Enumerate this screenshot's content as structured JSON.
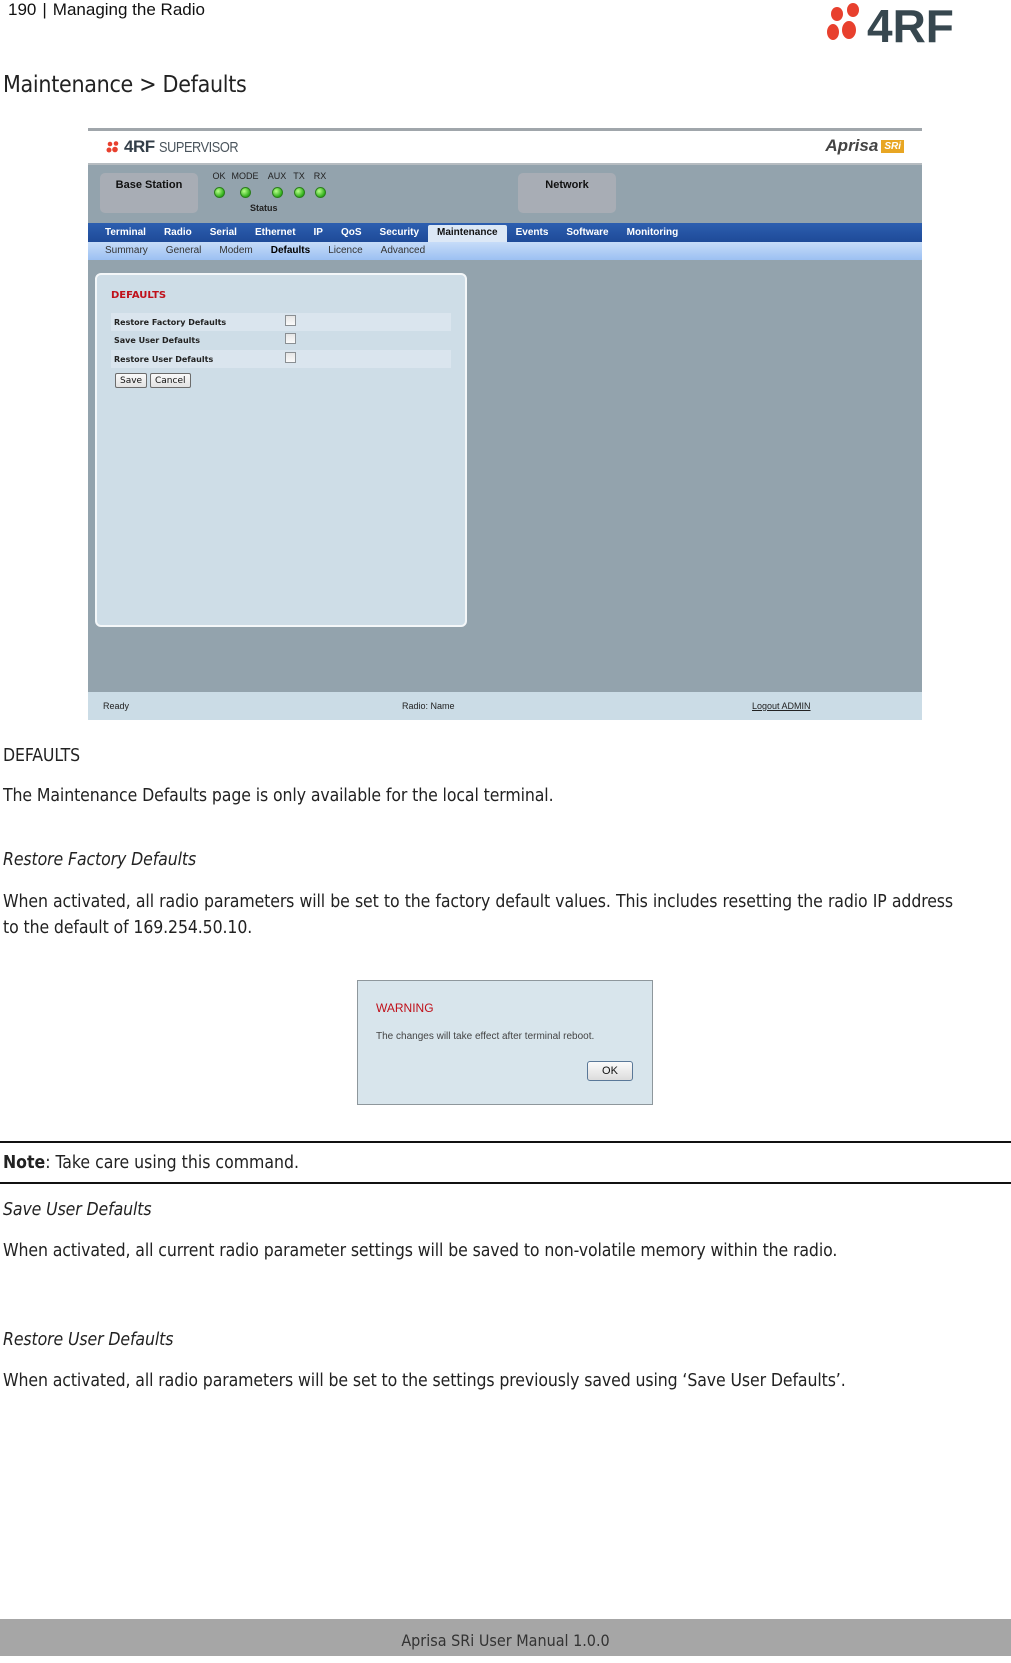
{
  "header": {
    "page_number": "190",
    "chapter": "Managing the Radio",
    "logo": "4RF"
  },
  "section_title": "Maintenance > Defaults",
  "app": {
    "logo_brand": "4RF",
    "logo_product": "SUPERVISOR",
    "aprisa_name": "Aprisa",
    "aprisa_badge": "SRi",
    "base_station_label": "Base Station",
    "network_label": "Network",
    "leds": [
      {
        "label": "OK",
        "state": "green"
      },
      {
        "label": "MODE",
        "state": "green"
      },
      {
        "label": "AUX",
        "state": "green"
      },
      {
        "label": "TX",
        "state": "green"
      },
      {
        "label": "RX",
        "state": "green"
      }
    ],
    "status_label": "Status",
    "tabs": [
      {
        "label": "Terminal"
      },
      {
        "label": "Radio"
      },
      {
        "label": "Serial"
      },
      {
        "label": "Ethernet"
      },
      {
        "label": "IP"
      },
      {
        "label": "QoS"
      },
      {
        "label": "Security"
      },
      {
        "label": "Maintenance",
        "active": true
      },
      {
        "label": "Events"
      },
      {
        "label": "Software"
      },
      {
        "label": "Monitoring"
      }
    ],
    "subtabs": [
      {
        "label": "Summary"
      },
      {
        "label": "General"
      },
      {
        "label": "Modem"
      },
      {
        "label": "Defaults",
        "active": true
      },
      {
        "label": "Licence"
      },
      {
        "label": "Advanced"
      }
    ],
    "panel": {
      "title": "DEFAULTS",
      "rows": [
        {
          "label": "Restore Factory Defaults",
          "checked": false
        },
        {
          "label": "Save User Defaults",
          "checked": false
        },
        {
          "label": "Restore User Defaults",
          "checked": false
        }
      ],
      "save_label": "Save",
      "cancel_label": "Cancel"
    },
    "statusbar": {
      "ready": "Ready",
      "radio": "Radio: Name",
      "logout": "Logout ADMIN"
    }
  },
  "body": {
    "defaults_heading": "DEFAULTS",
    "intro": "The Maintenance Defaults page is only available for the local terminal.",
    "restore_factory_heading": "Restore Factory Defaults",
    "restore_factory_text": "When activated, all radio parameters will be set to the factory default values. This includes resetting the radio IP address to the default of 169.254.50.10.",
    "warning": {
      "title": "WARNING",
      "message": "The changes will take effect after terminal reboot.",
      "ok_label": "OK"
    },
    "note_label": "Note",
    "note_text": ": Take care using this command.",
    "save_user_heading": "Save User Defaults",
    "save_user_text": "When activated, all current radio parameter settings will be saved to non-volatile memory within the radio.",
    "restore_user_heading": "Restore User Defaults",
    "restore_user_text": "When activated, all radio parameters will be set to the settings previously saved using ‘Save User Defaults’."
  },
  "footer": {
    "text": "Aprisa SRi User Manual 1.0.0"
  }
}
